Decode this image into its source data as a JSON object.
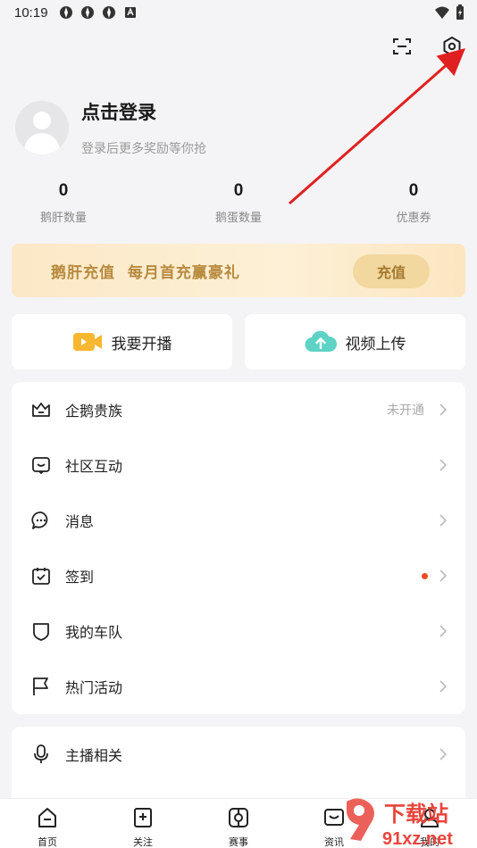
{
  "status_bar": {
    "time": "10:19"
  },
  "profile": {
    "title": "点击登录",
    "subtitle": "登录后更多奖励等你抢"
  },
  "stats": [
    {
      "value": "0",
      "label": "鹅肝数量"
    },
    {
      "value": "0",
      "label": "鹅蛋数量"
    },
    {
      "value": "0",
      "label": "优惠券"
    }
  ],
  "banner": {
    "text": "鹅肝充值  每月首充赢豪礼",
    "button": "充值"
  },
  "actions": {
    "live": "我要开播",
    "upload": "视频上传"
  },
  "menu": [
    {
      "label": "企鹅贵族",
      "right": "未开通",
      "icon": "crown-icon"
    },
    {
      "label": "社区互动",
      "right": "",
      "icon": "chat-box-icon"
    },
    {
      "label": "消息",
      "right": "",
      "icon": "message-icon"
    },
    {
      "label": "签到",
      "right": "",
      "icon": "calendar-check-icon"
    },
    {
      "label": "我的车队",
      "right": "",
      "icon": "shield-icon"
    },
    {
      "label": "热门活动",
      "right": "",
      "icon": "flag-icon"
    }
  ],
  "menu2": [
    {
      "label": "主播相关",
      "icon": "microphone-icon"
    }
  ],
  "tabs": [
    {
      "label": "首页",
      "icon": "home-icon"
    },
    {
      "label": "关注",
      "icon": "follow-icon"
    },
    {
      "label": "赛事",
      "icon": "match-icon"
    },
    {
      "label": "资讯",
      "icon": "news-icon"
    },
    {
      "label": "我的",
      "icon": "profile-icon"
    }
  ],
  "watermark": {
    "text1": "下载站",
    "text2": "91xz.net"
  },
  "colors": {
    "accent": "#f04b23",
    "banner_text": "#b88a3e",
    "arrow": "#e02020"
  }
}
